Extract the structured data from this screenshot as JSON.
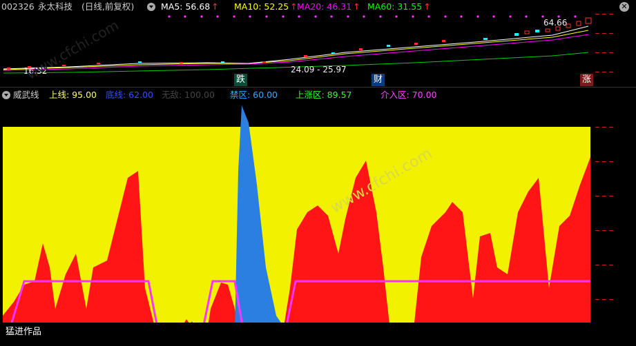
{
  "main": {
    "code": "002326",
    "name": "永太科技",
    "period": "(日线,前复权)",
    "ma": [
      {
        "label": "MA5: 56.68",
        "color": "#ffffff"
      },
      {
        "label": "MA10: 52.25",
        "color": "#ffff00"
      },
      {
        "label": "MA20: 46.31",
        "color": "#ff00ff"
      },
      {
        "label": "MA60: 31.55",
        "color": "#00ff00"
      }
    ],
    "high_label": "64.66",
    "low_label": "16.32",
    "range_label": "24.09 - 25.97",
    "markers": [
      "跌",
      "财",
      "涨"
    ],
    "watermark": "www.cfchi.com"
  },
  "indicator": {
    "name": "威武线",
    "params": [
      {
        "label": "上线: 95.00",
        "color": "#ffff66"
      },
      {
        "label": "底线: 62.00",
        "color": "#3050ff"
      },
      {
        "label": "无敌: 100.00",
        "color": "#444444"
      },
      {
        "label": "禁区: 60.00",
        "color": "#33aaff"
      },
      {
        "label": "上涨区: 89.57",
        "color": "#33ff33"
      },
      {
        "label": "介入区: 70.00",
        "color": "#ff44ff"
      }
    ],
    "footer": "猛进作品",
    "watermark": "www.cfchi.com",
    "colors": {
      "bg": "#f2f200",
      "area": "#ff1515",
      "forbidden": "#2a7fe0",
      "bottom": "#0a1a7a",
      "line": "#ff33ff"
    }
  }
}
